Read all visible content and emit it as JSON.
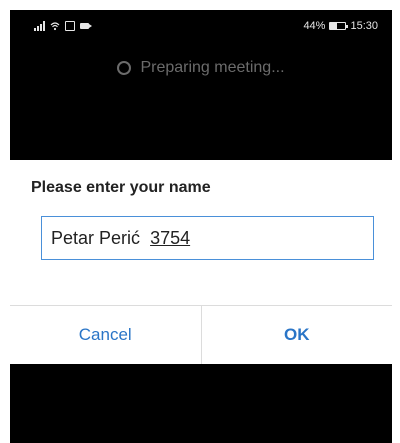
{
  "status_bar": {
    "icons_left": [
      "signal-icon",
      "wifi-icon",
      "vibrate-icon",
      "camera-icon"
    ],
    "battery_percent": "44%",
    "battery_level": 0.44,
    "time": "15:30"
  },
  "preparing": {
    "text": "Preparing meeting..."
  },
  "dialog": {
    "title": "Please enter your name",
    "input": {
      "value_committed": "Petar Perić",
      "value_composing": "3754"
    },
    "cancel_label": "Cancel",
    "ok_label": "OK",
    "accent_color": "#2a75c7"
  }
}
